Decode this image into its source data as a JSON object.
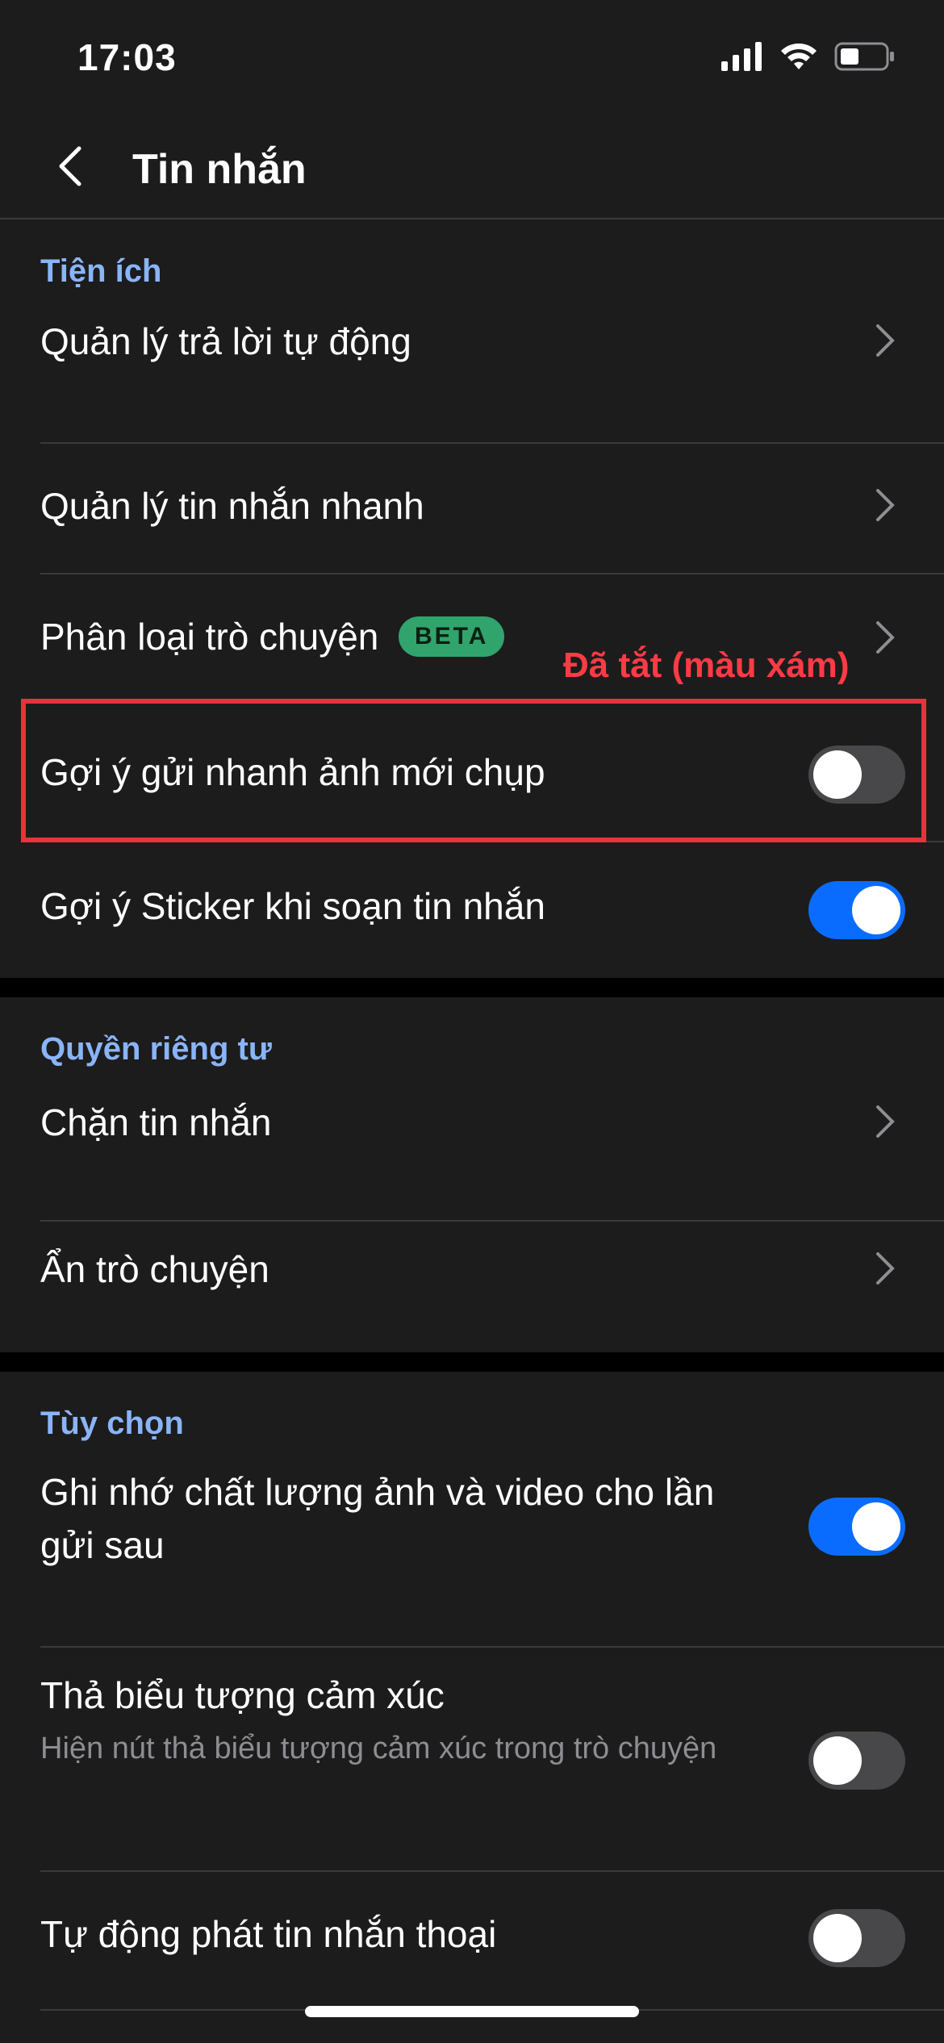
{
  "status_bar": {
    "time": "17:03"
  },
  "nav": {
    "title": "Tin nhắn"
  },
  "sections": {
    "utilities": {
      "header": "Tiện ích",
      "items": [
        {
          "label": "Quản lý trả lời tự động"
        },
        {
          "label": "Quản lý tin nhắn nhanh"
        },
        {
          "label": "Phân loại trò chuyện",
          "badge": "BETA"
        },
        {
          "label": "Gợi ý gửi nhanh ảnh mới chụp",
          "toggle": false
        },
        {
          "label": "Gợi ý Sticker khi soạn tin nhắn",
          "toggle": true
        }
      ]
    },
    "privacy": {
      "header": "Quyền riêng tư",
      "items": [
        {
          "label": "Chặn tin nhắn"
        },
        {
          "label": "Ẩn trò chuyện"
        }
      ]
    },
    "options": {
      "header": "Tùy chọn",
      "items": [
        {
          "label": "Ghi nhớ chất lượng ảnh và video cho lần gửi sau",
          "toggle": true
        },
        {
          "label": "Thả biểu tượng cảm xúc",
          "sublabel": "Hiện nút thả biểu tượng cảm xúc trong trò chuyện",
          "toggle": false
        },
        {
          "label": "Tự động phát tin nhắn thoại",
          "toggle": false
        }
      ]
    }
  },
  "annotation": {
    "text": "Đã tắt (màu xám)",
    "color": "#ff3b44"
  },
  "colors": {
    "accent_blue": "#0a6cff",
    "section_header": "#8ab4f8",
    "beta_green": "#30a46c"
  }
}
